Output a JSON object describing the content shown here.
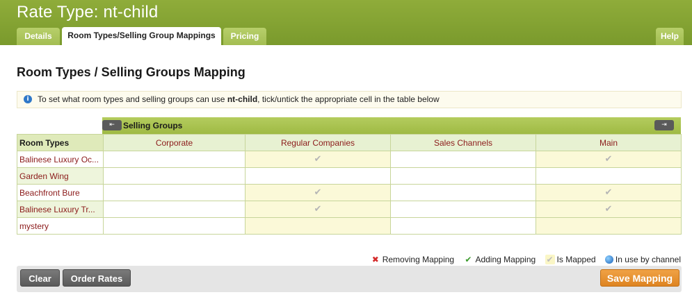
{
  "header": {
    "title": "Rate Type: nt-child",
    "tabs": [
      {
        "label": "Details",
        "active": false
      },
      {
        "label": "Room Types/Selling Group Mappings",
        "active": true
      },
      {
        "label": "Pricing",
        "active": false
      }
    ],
    "help_label": "Help"
  },
  "section": {
    "title": "Room Types / Selling Groups Mapping",
    "info_prefix": "To set what room types and selling groups can use ",
    "info_rate": "nt-child",
    "info_suffix": ", tick/untick the appropriate cell in the table below"
  },
  "table": {
    "selling_groups_label": "Selling Groups",
    "nav_prev_icon": "⇤",
    "nav_next_icon": "⇥",
    "room_types_header": "Room Types",
    "columns": [
      "Corporate",
      "Regular Companies",
      "Sales Channels",
      "Main"
    ],
    "rows": [
      {
        "name": "Balinese Luxury Oc...",
        "mapped": [
          false,
          true,
          false,
          true
        ]
      },
      {
        "name": "Garden Wing",
        "mapped": [
          false,
          false,
          false,
          false
        ]
      },
      {
        "name": "Beachfront Bure",
        "mapped": [
          false,
          true,
          false,
          true
        ]
      },
      {
        "name": "Balinese Luxury Tr...",
        "mapped": [
          false,
          true,
          false,
          true
        ]
      },
      {
        "name": "mystery",
        "mapped": [
          false,
          false,
          false,
          false
        ]
      }
    ],
    "check_glyph": "✔"
  },
  "legend": {
    "removing": "Removing Mapping",
    "adding": "Adding Mapping",
    "mapped": "Is Mapped",
    "channel": "In use by channel",
    "removing_icon": "✖",
    "adding_icon": "✔",
    "mapped_icon": "✔"
  },
  "buttons": {
    "clear": "Clear",
    "order_rates": "Order Rates",
    "save": "Save Mapping"
  },
  "colors": {
    "header_green": "#8fac3a",
    "accent_orange": "#e38c2a",
    "room_type_text": "#8b1a1a"
  }
}
